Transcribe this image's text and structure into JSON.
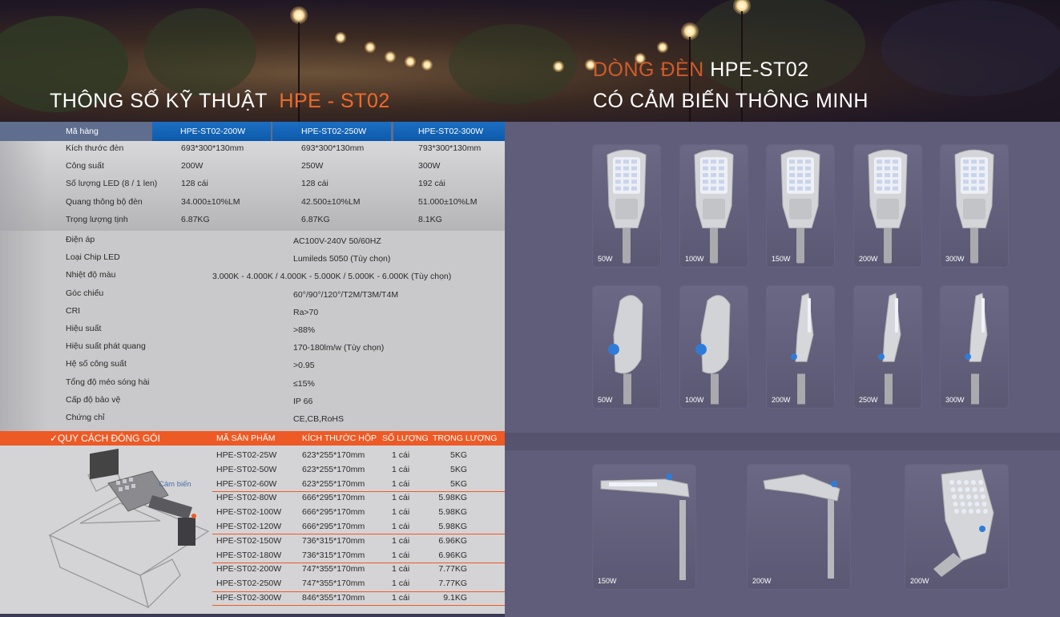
{
  "header": {
    "left_title": "THÔNG SỐ KỸ THUẬT",
    "left_model": "HPE - ST02",
    "right_line1_prefix": "DÒNG ĐÈN",
    "right_line1_model": "HPE-ST02",
    "right_line2": "CÓ CẢM BIẾN THÔNG MINH"
  },
  "colors": {
    "accent_orange": "#ee5a25",
    "header_blue": "#1565c0",
    "panel_bg": "#5f5d79",
    "table_bg": "#c9c9cb"
  },
  "spec": {
    "header": {
      "label": "Mã hàng",
      "models": [
        "HPE-ST02-200W",
        "HPE-ST02-250W",
        "HPE-ST02-300W"
      ]
    },
    "variant_rows": [
      {
        "label": "Kích thước đèn",
        "values": [
          "693*300*130mm",
          "693*300*130mm",
          "793*300*130mm"
        ]
      },
      {
        "label": "Công suất",
        "values": [
          "200W",
          "250W",
          "300W"
        ]
      },
      {
        "label": "Số lượng LED (8 / 1 len)",
        "values": [
          "128 cái",
          "128 cái",
          "192 cái"
        ]
      },
      {
        "label": "Quang thông bộ đèn",
        "values": [
          "34.000±10%LM",
          "42.500±10%LM",
          "51.000±10%LM"
        ]
      },
      {
        "label": "Trọng lượng tịnh",
        "values": [
          "6.87KG",
          "6.87KG",
          "8.1KG"
        ]
      }
    ],
    "common_rows": [
      {
        "label": "Điện áp",
        "value": "AC100V-240V 50/60HZ"
      },
      {
        "label": "Loại  Chip LED",
        "value": "Lumileds 5050 (Tùy chọn)"
      },
      {
        "label": " Nhiệt độ màu",
        "value": "3.000K - 4.000K / 4.000K - 5.000K / 5.000K - 6.000K (Tùy chọn)"
      },
      {
        "label": "Góc chiếu",
        "value": "60°/90°/120°/T2M/T3M/T4M"
      },
      {
        "label": "CRI",
        "value": "Ra>70"
      },
      {
        "label": "Hiệu suất",
        "value": ">88%"
      },
      {
        "label": "Hiệu suất phát quang",
        "value": "170-180lm/w (Tùy chọn)"
      },
      {
        "label": "Hệ số công suất",
        "value": ">0.95"
      },
      {
        "label": "Tổng độ méo sóng hài",
        "value": "≤15%"
      },
      {
        "label": "Cấp độ bảo vệ",
        "value": "IP 66"
      },
      {
        "label": "Chứng chỉ",
        "value": "CE,CB,RoHS"
      }
    ]
  },
  "packing": {
    "title": "✓QUY CÁCH ĐÓNG GÓI",
    "columns": [
      "MÃ SẢN PHẨM",
      "KÍCH THƯỚC HỘP",
      "SỐ LƯỢNG",
      "TRỌNG LƯỢNG"
    ],
    "sensor_label": "Cảm biến",
    "rows": [
      [
        "HPE-ST02-25W",
        "623*255*170mm",
        "1 cái",
        "5KG"
      ],
      [
        "HPE-ST02-50W",
        "623*255*170mm",
        "1 cái",
        "5KG"
      ],
      [
        "HPE-ST02-60W",
        "623*255*170mm",
        "1 cái",
        "5KG"
      ],
      [
        "HPE-ST02-80W",
        "666*295*170mm",
        "1 cái",
        "5.98KG"
      ],
      [
        "HPE-ST02-100W",
        "666*295*170mm",
        "1 cái",
        "5.98KG"
      ],
      [
        "HPE-ST02-120W",
        "666*295*170mm",
        "1 cái",
        "5.98KG"
      ],
      [
        "HPE-ST02-150W",
        "736*315*170mm",
        "1 cái",
        "6.96KG"
      ],
      [
        "HPE-ST02-180W",
        "736*315*170mm",
        "1 cái",
        "6.96KG"
      ],
      [
        "HPE-ST02-200W",
        "747*355*170mm",
        "1 cái",
        "7.77KG"
      ],
      [
        "HPE-ST02-250W",
        "747*355*170mm",
        "1 cái",
        "7.77KG"
      ],
      [
        "HPE-ST02-300W",
        "846*355*170mm",
        "1 cái",
        "9.1KG"
      ]
    ]
  },
  "gallery": {
    "front_row": [
      "50W",
      "100W",
      "150W",
      "200W",
      "300W"
    ],
    "side_row": [
      "50W",
      "100W",
      "200W",
      "250W",
      "300W"
    ],
    "angle_row": [
      "150W",
      "200W",
      "200W"
    ]
  }
}
